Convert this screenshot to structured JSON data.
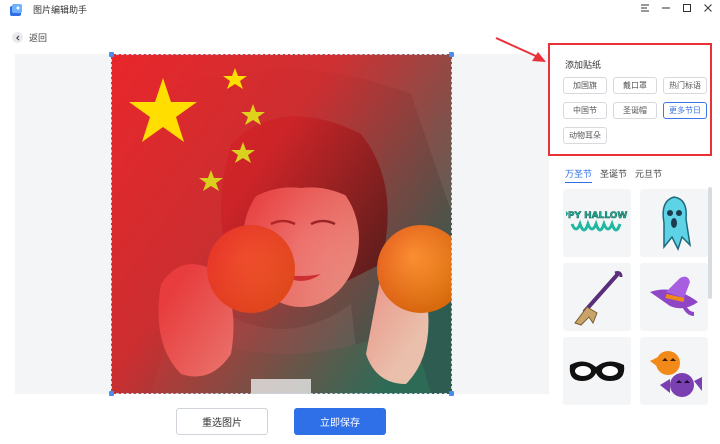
{
  "window": {
    "title": "图片编辑助手",
    "icons": [
      "app-logo-icon",
      "menu-icon",
      "minimize-icon",
      "maximize-icon",
      "close-icon"
    ]
  },
  "nav": {
    "back_label": "返回"
  },
  "sticker_panel": {
    "title": "添加贴纸",
    "categories": [
      {
        "label": "加国旗",
        "active": false
      },
      {
        "label": "戴口罩",
        "active": false
      },
      {
        "label": "热门标语",
        "active": false
      },
      {
        "label": "中国节",
        "active": false
      },
      {
        "label": "圣诞帽",
        "active": false
      },
      {
        "label": "更多节日",
        "active": true
      },
      {
        "label": "动物耳朵",
        "active": false
      }
    ],
    "highlight_color": "#e8323a"
  },
  "holiday_tabs": [
    {
      "label": "万圣节",
      "active": true
    },
    {
      "label": "圣诞节",
      "active": false
    },
    {
      "label": "元旦节",
      "active": false
    }
  ],
  "stickers": [
    {
      "name": "happy-halloween-sticker",
      "text": "HAPPY HALLOWEEN"
    },
    {
      "name": "ghost-sticker"
    },
    {
      "name": "broom-sticker"
    },
    {
      "name": "witch-hat-sticker"
    },
    {
      "name": "mask-sticker"
    },
    {
      "name": "pumpkin-candy-sticker"
    }
  ],
  "buttons": {
    "reselect": "重选图片",
    "save": "立即保存"
  },
  "colors": {
    "accent": "#2f6fe8",
    "flag_red": "#e8262b",
    "flag_yellow": "#ffde00"
  }
}
